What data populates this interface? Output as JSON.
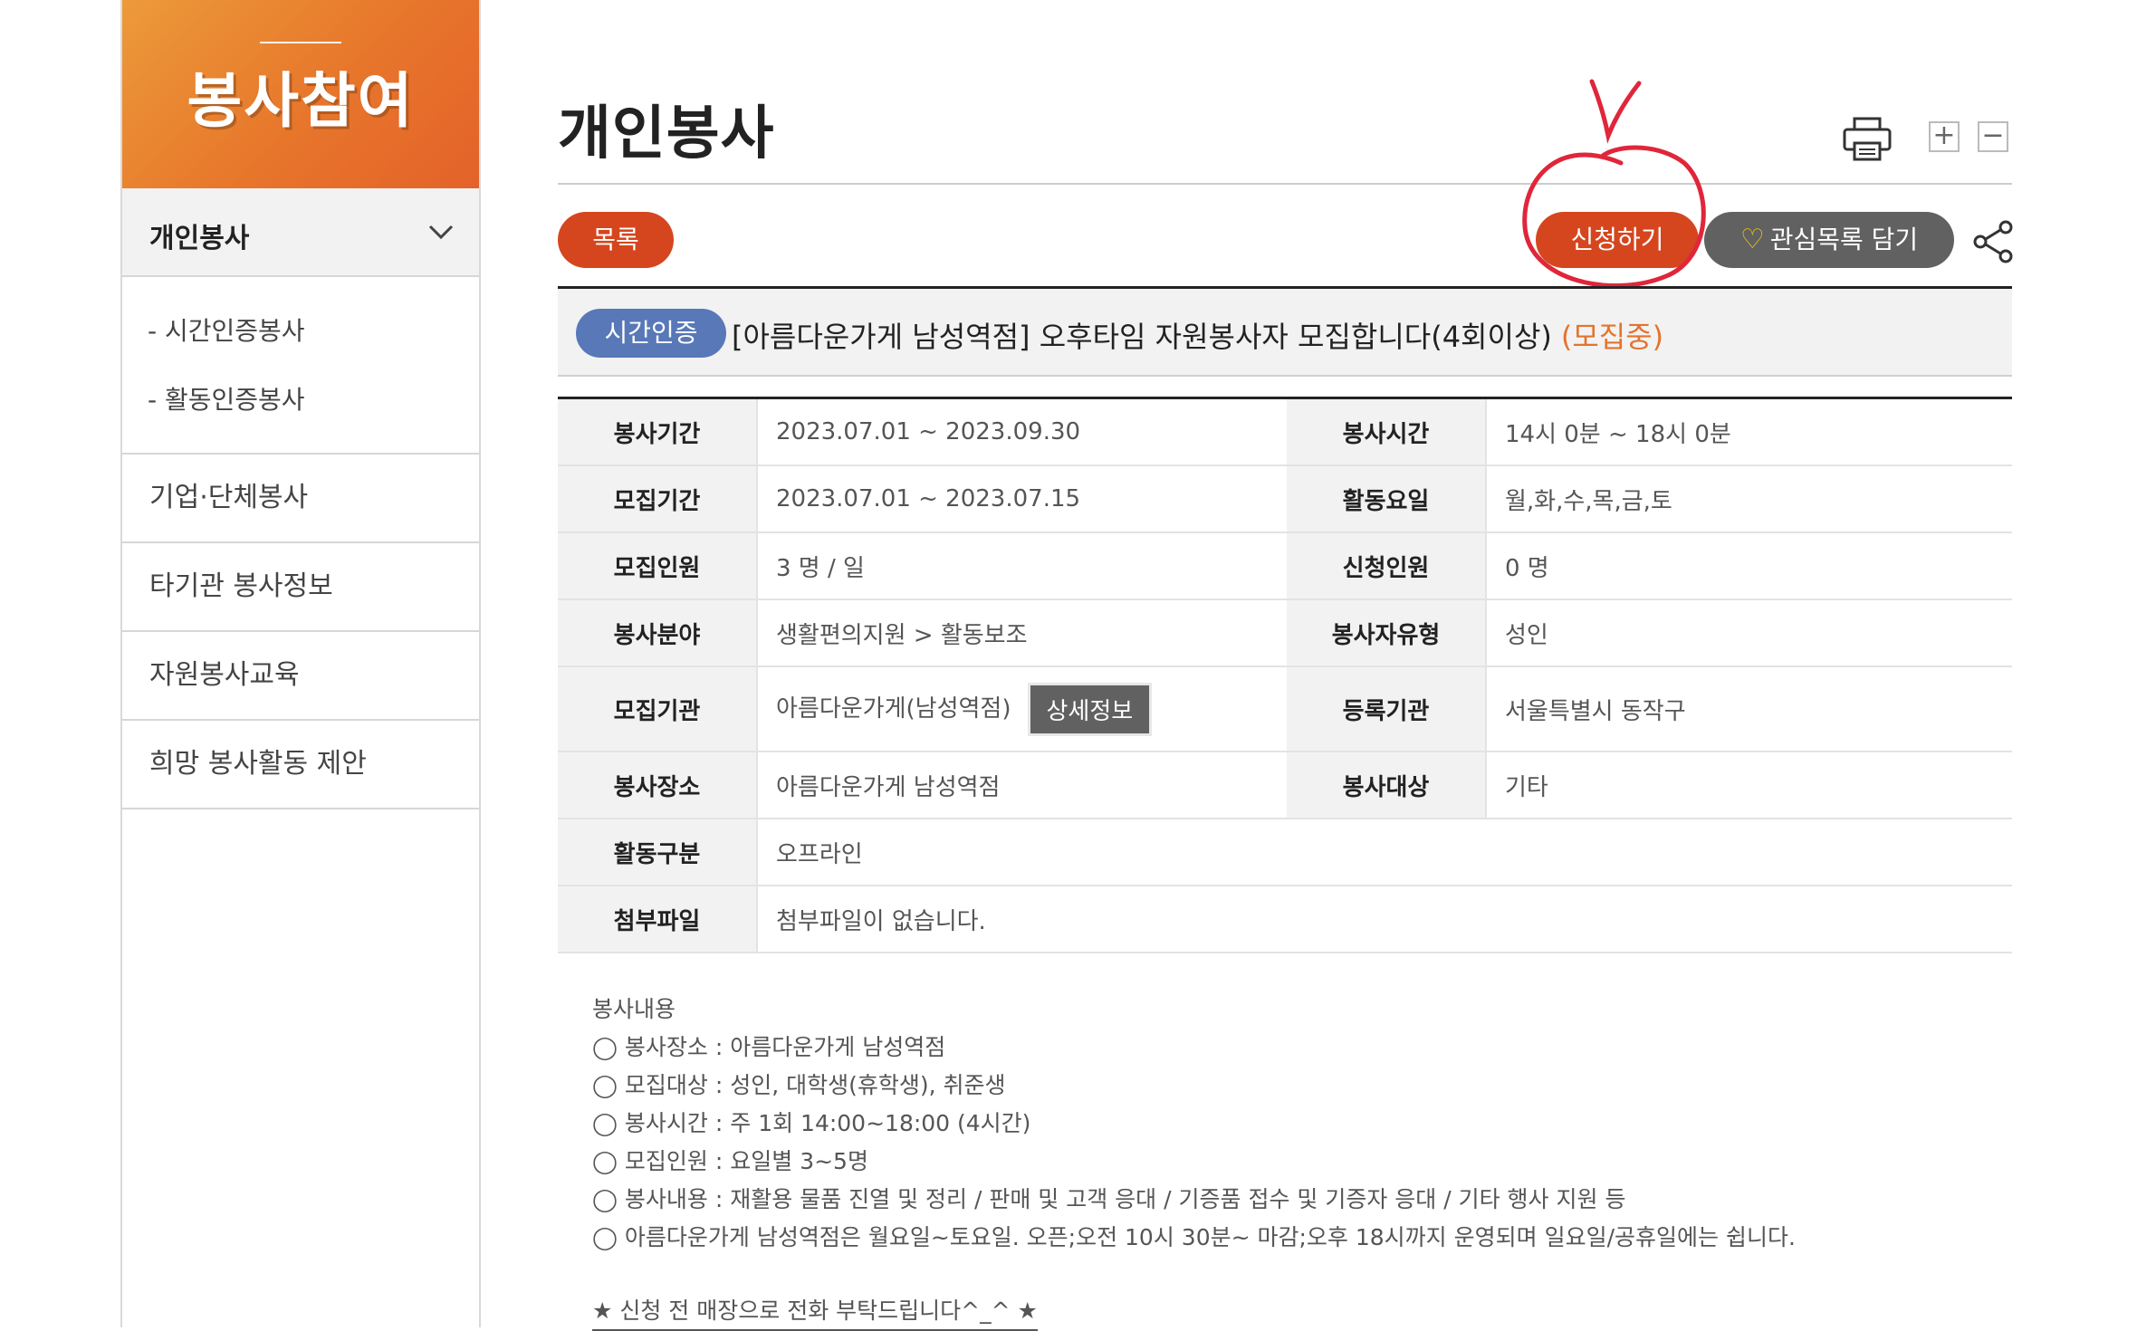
{
  "sidebar": {
    "header_title": "봉사참여",
    "active_item": "개인봉사",
    "sub_items": [
      "- 시간인증봉사",
      "- 활동인증봉사"
    ],
    "items": [
      "기업·단체봉사",
      "타기관 봉사정보",
      "자원봉사교육",
      "희망 봉사활동 제안"
    ]
  },
  "page": {
    "title": "개인봉사",
    "zoom_in": "+",
    "zoom_out": "−"
  },
  "actions": {
    "list_label": "목록",
    "apply_label": "신청하기",
    "favorite_label": "관심목록 담기"
  },
  "post": {
    "badge": "시간인증",
    "title": "[아름다운가게 남성역점] 오후타임 자원봉사자 모집합니다(4회이상)",
    "status": "(모집중)"
  },
  "details": {
    "rows": [
      {
        "l1": "봉사기간",
        "v1": "2023.07.01 ~ 2023.09.30",
        "l2": "봉사시간",
        "v2": "14시 0분 ~ 18시 0분"
      },
      {
        "l1": "모집기간",
        "v1": "2023.07.01 ~ 2023.07.15",
        "l2": "활동요일",
        "v2": "월,화,수,목,금,토"
      },
      {
        "l1": "모집인원",
        "v1": "3 명 / 일",
        "l2": "신청인원",
        "v2": "0 명"
      },
      {
        "l1": "봉사분야",
        "v1": "생활편의지원 > 활동보조",
        "l2": "봉사자유형",
        "v2": "성인"
      },
      {
        "l1": "모집기관",
        "v1": "아름다운가게(남성역점)",
        "l2": "등록기관",
        "v2": "서울특별시 동작구"
      },
      {
        "l1": "봉사장소",
        "v1": "아름다운가게 남성역점",
        "l2": "봉사대상",
        "v2": "기타"
      },
      {
        "l1": "활동구분",
        "v1": "오프라인"
      },
      {
        "l1": "첨부파일",
        "v1": "첨부파일이 없습니다."
      }
    ],
    "detail_button": "상세정보"
  },
  "content": {
    "heading": "봉사내용",
    "lines": [
      "◯ 봉사장소 : 아름다운가게 남성역점",
      "◯ 모집대상 : 성인, 대학생(휴학생), 취준생",
      "◯ 봉사시간 : 주 1회 14:00~18:00 (4시간)",
      "◯ 모집인원 : 요일별 3~5명",
      "◯ 봉사내용 : 재활용 물품 진열 및 정리 / 판매 및 고객 응대 / 기증품 접수 및 기증자 응대 / 기타 행사 지원 등",
      "◯ 아름다운가게 남성역점은 월요일~토요일. 오픈;오전 10시 30분~ 마감;오후 18시까지 운영되며 일요일/공휴일에는 쉽니다."
    ],
    "note": "★ 신청 전 매장으로 전화 부탁드립니다^_^ ★"
  },
  "colors": {
    "accent": "#d5461f",
    "badge": "#5878b8",
    "status": "#e5732b",
    "dark_button": "#616161",
    "annotation": "#e0263a"
  }
}
